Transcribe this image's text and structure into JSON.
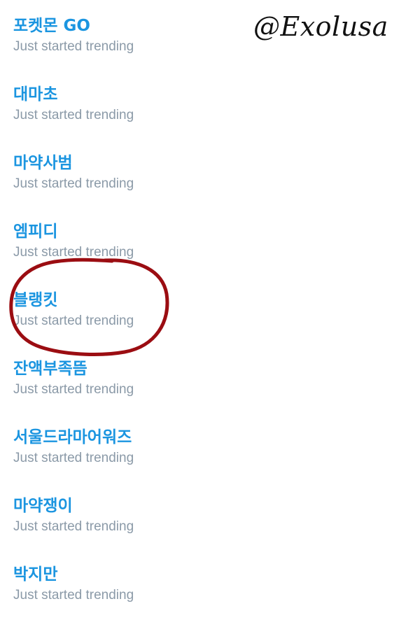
{
  "watermark": "@Exolusa",
  "colors": {
    "title": "#1b95e0",
    "subtitle": "#8b9aa8",
    "highlight": "#9b0d12"
  },
  "trends": [
    {
      "title": "포켓몬 GO",
      "subtitle": "Just started trending"
    },
    {
      "title": "대마초",
      "subtitle": "Just started trending"
    },
    {
      "title": "마약사범",
      "subtitle": "Just started trending"
    },
    {
      "title": "엠피디",
      "subtitle": "Just started trending"
    },
    {
      "title": "블랭킷",
      "subtitle": "Just started trending"
    },
    {
      "title": "잔액부족뜸",
      "subtitle": "Just started trending"
    },
    {
      "title": "서울드라마어워즈",
      "subtitle": "Just started trending"
    },
    {
      "title": "마약쟁이",
      "subtitle": "Just started trending"
    },
    {
      "title": "박지만",
      "subtitle": "Just started trending"
    }
  ]
}
